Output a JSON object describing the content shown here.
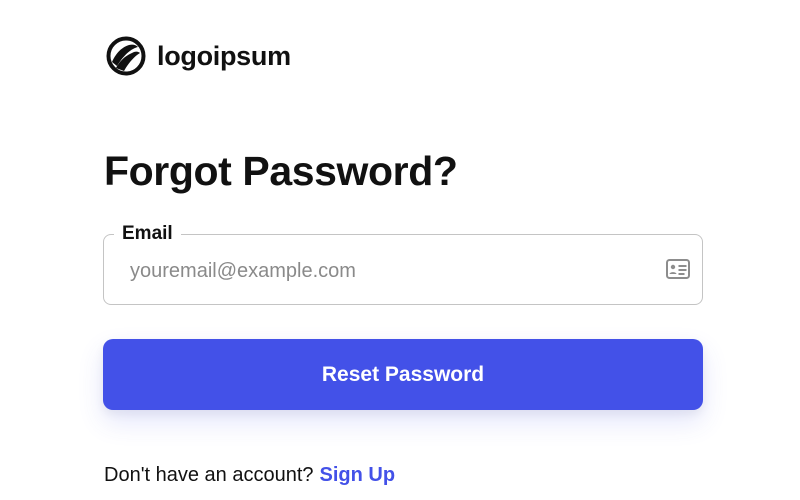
{
  "brand": {
    "name": "logoipsum",
    "logo_icon": "logoipsum-mark"
  },
  "page": {
    "title": "Forgot Password?"
  },
  "form": {
    "email_label": "Email",
    "email_placeholder": "youremail@example.com",
    "email_value": "",
    "email_icon": "id-card-icon",
    "submit_label": "Reset Password"
  },
  "footer": {
    "prompt": "Don't have an account?",
    "signup_label": "Sign Up"
  },
  "colors": {
    "accent": "#4351e8",
    "text": "#111111",
    "border": "#c4c4c4",
    "placeholder": "#8a8a8a"
  }
}
